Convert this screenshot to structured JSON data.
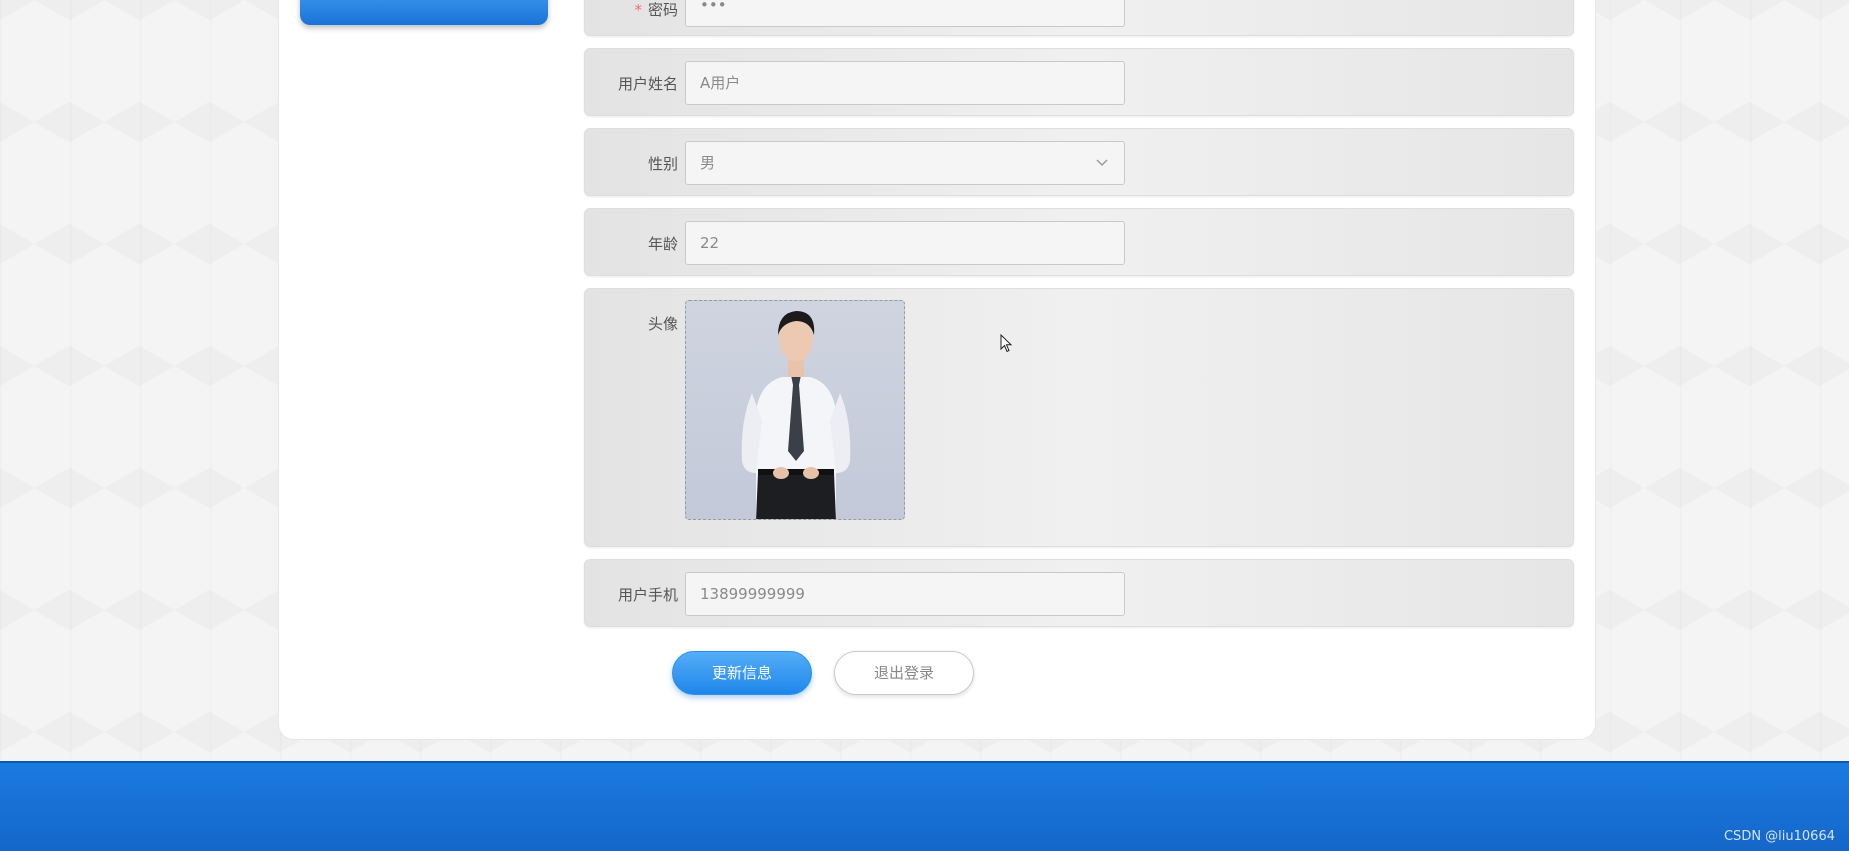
{
  "form": {
    "password": {
      "label": "密码",
      "value": "•••"
    },
    "username": {
      "label": "用户姓名",
      "value": "A用户"
    },
    "gender": {
      "label": "性别",
      "value": "男"
    },
    "age": {
      "label": "年龄",
      "value": "22"
    },
    "avatar": {
      "label": "头像"
    },
    "phone": {
      "label": "用户手机",
      "value": "13899999999"
    }
  },
  "actions": {
    "update_label": "更新信息",
    "logout_label": "退出登录"
  },
  "footer": {
    "watermark": "CSDN @liu10664"
  },
  "colors": {
    "primary": "#1e86ea",
    "footer": "#1566c9",
    "required": "#f56c6c"
  }
}
